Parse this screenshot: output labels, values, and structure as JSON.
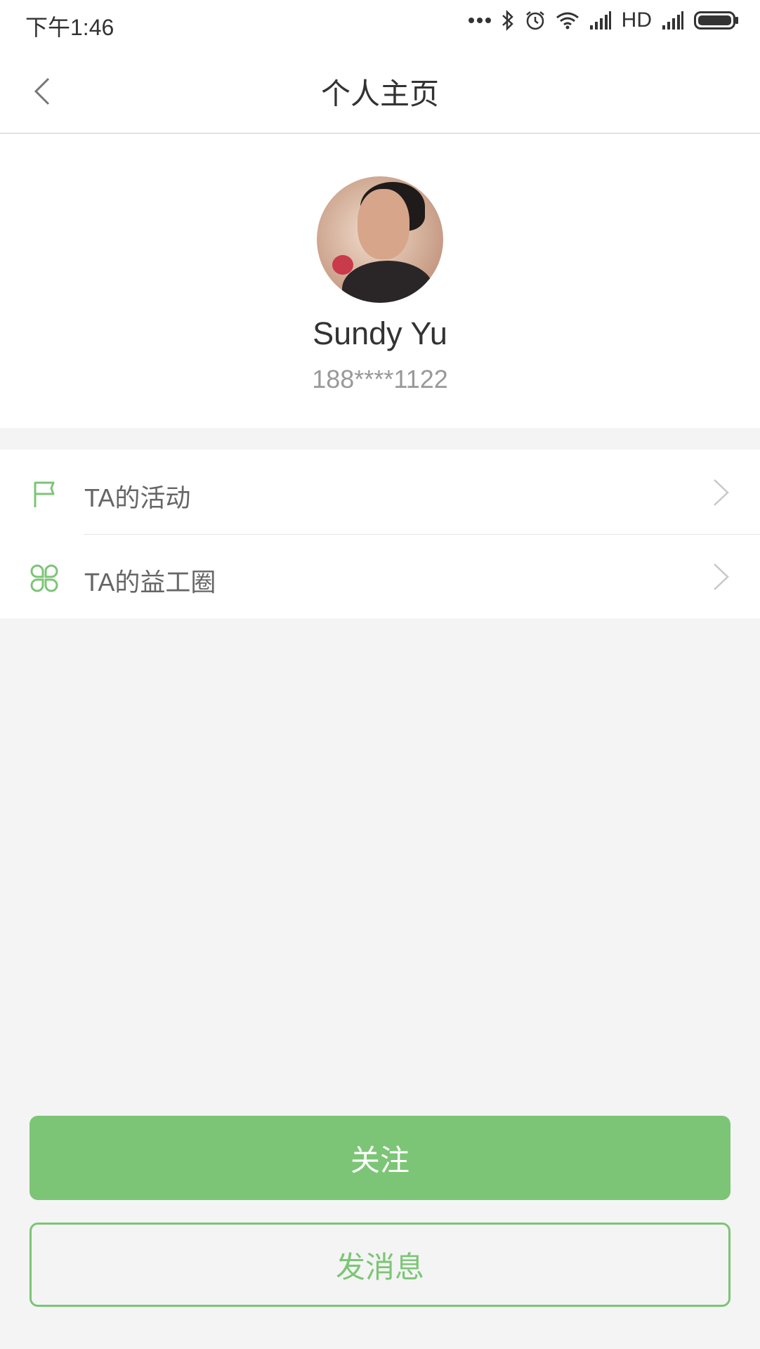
{
  "status_bar": {
    "time": "下午1:46",
    "network_label": "HD",
    "icons": [
      "more-dots-icon",
      "bluetooth-icon",
      "alarm-icon",
      "wifi-icon",
      "signal-icon",
      "signal-icon-2",
      "battery-icon"
    ]
  },
  "navbar": {
    "title": "个人主页",
    "back_icon": "chevron-left-icon"
  },
  "profile": {
    "name": "Sundy Yu",
    "phone": "188****1122"
  },
  "menu": {
    "items": [
      {
        "label": "TA的活动",
        "icon": "flag-icon"
      },
      {
        "label": "TA的益工圈",
        "icon": "clover-icon"
      }
    ]
  },
  "actions": {
    "follow_label": "关注",
    "message_label": "发消息"
  },
  "colors": {
    "accent": "#7cc576",
    "name_text": "#333333",
    "phone_text": "#999999",
    "menu_text": "#666666",
    "background": "#f4f4f4"
  }
}
